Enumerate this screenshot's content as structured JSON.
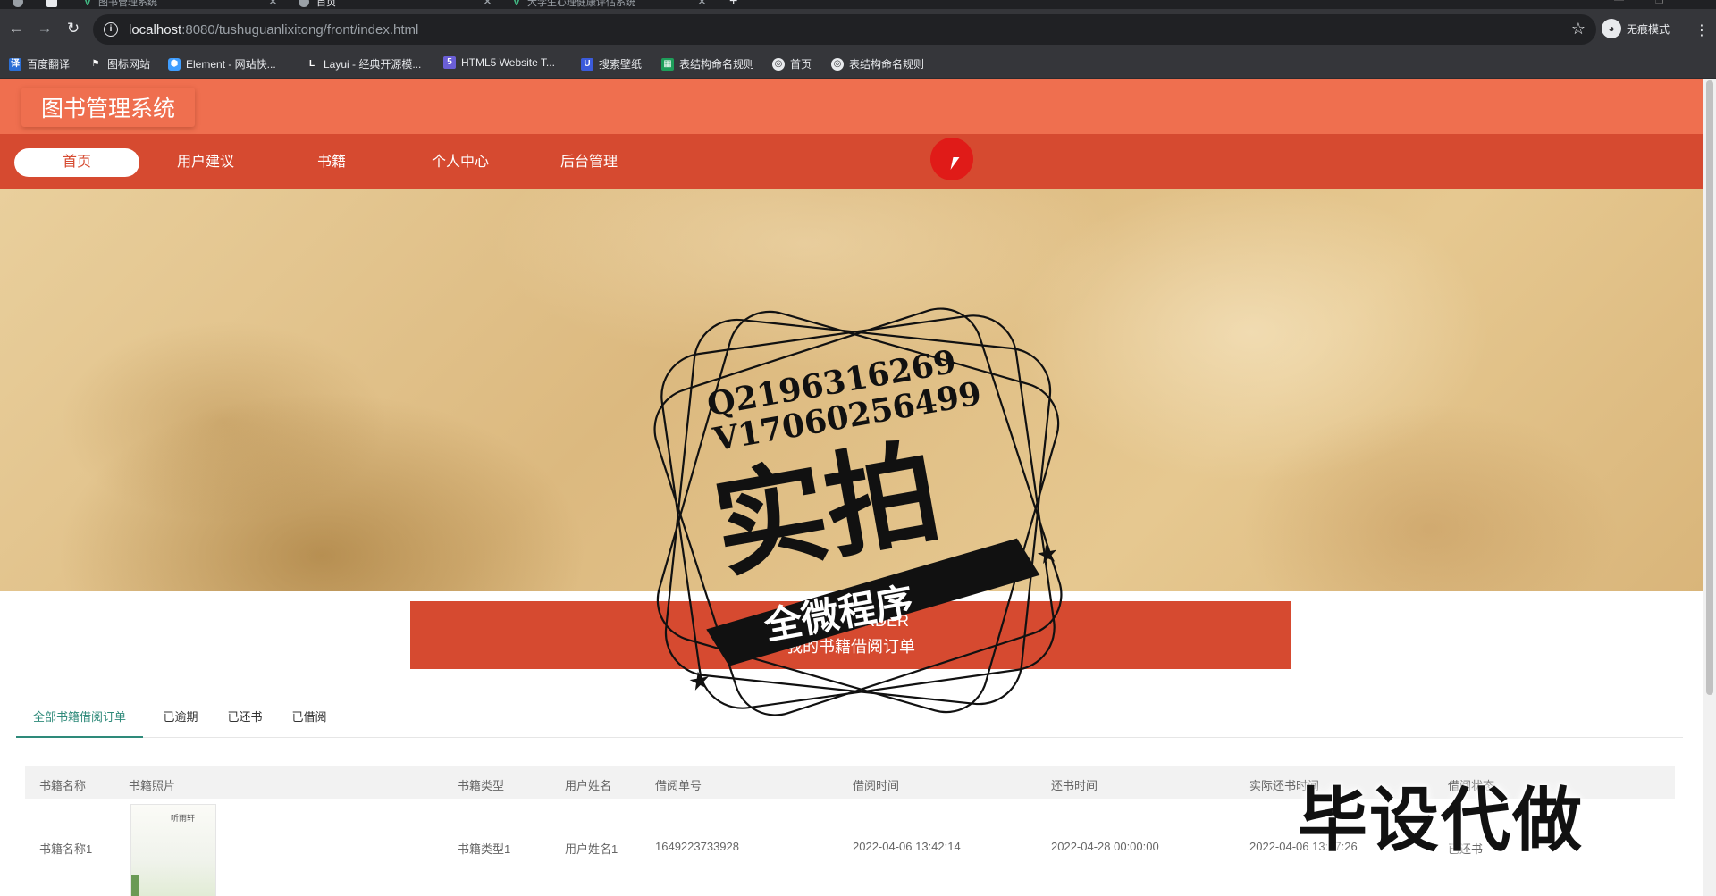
{
  "browser": {
    "tabs": [
      {
        "title": "图书管理系统",
        "active": false
      },
      {
        "title": "首页",
        "active": true
      },
      {
        "title": "大学生心理健康评估系统",
        "active": false
      }
    ],
    "url_host": "localhost",
    "url_rest": ":8080/tushuguanlixitong/front/index.html",
    "incognito_label": "无痕模式",
    "bookmarks": [
      "百度翻译",
      "图标网站",
      "Element - 网站快...",
      "Layui - 经典开源模...",
      "HTML5 Website T...",
      "搜索壁纸",
      "表结构命名规则",
      "首页",
      "表结构命名规则"
    ]
  },
  "site": {
    "title": "图书管理系统",
    "nav": [
      "首页",
      "用户建议",
      "书籍",
      "个人中心",
      "后台管理"
    ],
    "active_nav": 0
  },
  "watermark": {
    "q_line": "Q2196316269",
    "v_line": "V17060256499",
    "main": "实拍",
    "ribbon": "全微程序"
  },
  "order_section": {
    "english": "USER / ORDER",
    "chinese": "我的书籍借阅订单"
  },
  "subtabs": [
    "全部书籍借阅订单",
    "已逾期",
    "已还书",
    "已借阅"
  ],
  "active_subtab": 0,
  "table": {
    "headers": [
      "书籍名称",
      "书籍照片",
      "书籍类型",
      "用户姓名",
      "借阅单号",
      "借阅时间",
      "还书时间",
      "实际还书时间",
      "借阅状态"
    ],
    "rows": [
      {
        "book_name": "书籍名称1",
        "book_type": "书籍类型1",
        "user_name": "用户姓名1",
        "order_no": "1649223733928",
        "borrow_time": "2022-04-06 13:42:14",
        "return_time": "2022-04-28 00:00:00",
        "actual_return_time": "2022-04-06 13:57:26",
        "status": "已还书",
        "cover_title": "听雨轩"
      }
    ]
  },
  "overlay": "毕设代做",
  "colors": {
    "header": "#ef6f4f",
    "nav": "#d64a30",
    "accent": "#2e8a7a"
  }
}
